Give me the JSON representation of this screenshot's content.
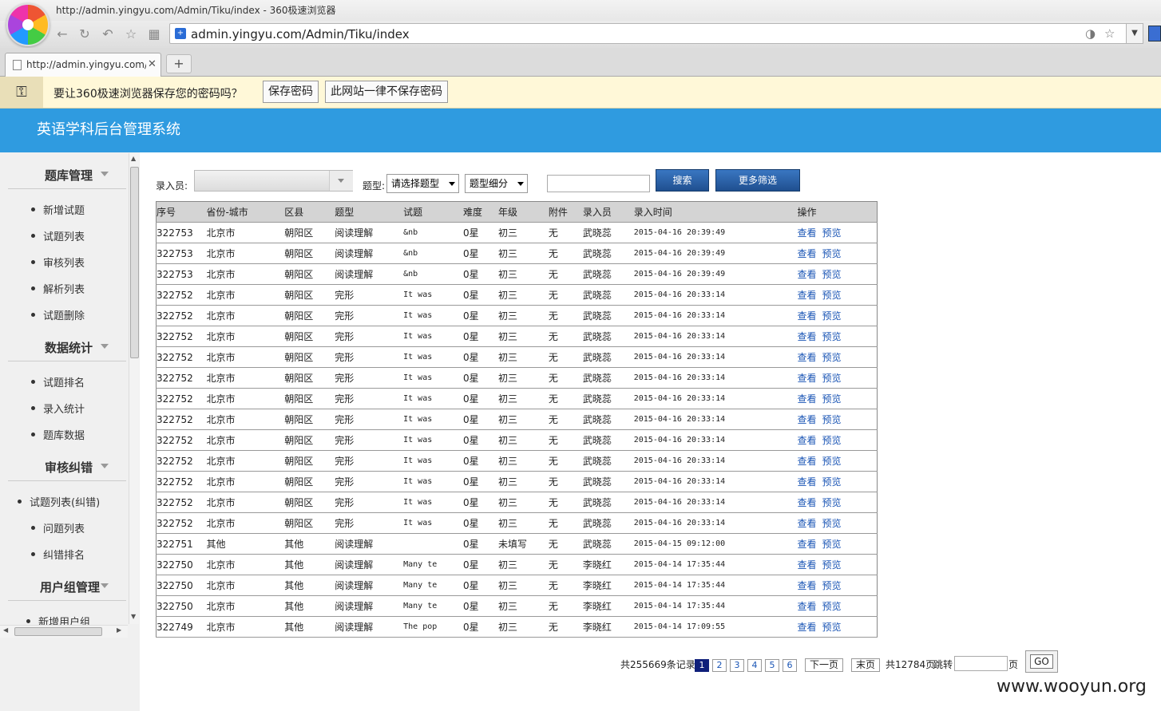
{
  "browser": {
    "window_title": "http://admin.yingyu.com/Admin/Tiku/index - 360极速浏览器",
    "url": "admin.yingyu.com/Admin/Tiku/index",
    "tab_title": "http://admin.yingyu.com/Admin/",
    "password_prompt": {
      "message": "要让360极速浏览器保存您的密码吗？",
      "save": "保存密码",
      "never": "此网站一律不保存密码"
    }
  },
  "app": {
    "title": "英语学科后台管理系统"
  },
  "sidebar": {
    "groups": [
      {
        "title": "题库管理",
        "items": [
          "新增试题",
          "试题列表",
          "审核列表",
          "解析列表",
          "试题删除"
        ]
      },
      {
        "title": "数据统计",
        "items": [
          "试题排名",
          "录入统计",
          "题库数据"
        ]
      },
      {
        "title": "审核纠错",
        "items": [
          "试题列表(纠错)",
          "问题列表",
          "纠错排名"
        ]
      },
      {
        "title": "用户组管理",
        "items": [
          "新增用户组"
        ]
      }
    ]
  },
  "filters": {
    "recorder_label": "录入员:",
    "type_label": "题型:",
    "type_select": "请选择题型",
    "subtype_select": "题型细分",
    "search": "搜索",
    "more": "更多筛选"
  },
  "table": {
    "headers": [
      "序号",
      "省份-城市",
      "区县",
      "题型",
      "试题",
      "难度",
      "年级",
      "附件",
      "录入员",
      "录入时间",
      "操作"
    ],
    "view": "查看",
    "preview": "预览",
    "rows": [
      [
        "322753",
        "北京市",
        "朝阳区",
        "阅读理解",
        "&nb",
        "0星",
        "初三",
        "无",
        "武晓蕊",
        "2015-04-16 20:39:49"
      ],
      [
        "322753",
        "北京市",
        "朝阳区",
        "阅读理解",
        "&nb",
        "0星",
        "初三",
        "无",
        "武晓蕊",
        "2015-04-16 20:39:49"
      ],
      [
        "322753",
        "北京市",
        "朝阳区",
        "阅读理解",
        "&nb",
        "0星",
        "初三",
        "无",
        "武晓蕊",
        "2015-04-16 20:39:49"
      ],
      [
        "322752",
        "北京市",
        "朝阳区",
        "完形",
        "It was",
        "0星",
        "初三",
        "无",
        "武晓蕊",
        "2015-04-16 20:33:14"
      ],
      [
        "322752",
        "北京市",
        "朝阳区",
        "完形",
        "It was",
        "0星",
        "初三",
        "无",
        "武晓蕊",
        "2015-04-16 20:33:14"
      ],
      [
        "322752",
        "北京市",
        "朝阳区",
        "完形",
        "It was",
        "0星",
        "初三",
        "无",
        "武晓蕊",
        "2015-04-16 20:33:14"
      ],
      [
        "322752",
        "北京市",
        "朝阳区",
        "完形",
        "It was",
        "0星",
        "初三",
        "无",
        "武晓蕊",
        "2015-04-16 20:33:14"
      ],
      [
        "322752",
        "北京市",
        "朝阳区",
        "完形",
        "It was",
        "0星",
        "初三",
        "无",
        "武晓蕊",
        "2015-04-16 20:33:14"
      ],
      [
        "322752",
        "北京市",
        "朝阳区",
        "完形",
        "It was",
        "0星",
        "初三",
        "无",
        "武晓蕊",
        "2015-04-16 20:33:14"
      ],
      [
        "322752",
        "北京市",
        "朝阳区",
        "完形",
        "It was",
        "0星",
        "初三",
        "无",
        "武晓蕊",
        "2015-04-16 20:33:14"
      ],
      [
        "322752",
        "北京市",
        "朝阳区",
        "完形",
        "It was",
        "0星",
        "初三",
        "无",
        "武晓蕊",
        "2015-04-16 20:33:14"
      ],
      [
        "322752",
        "北京市",
        "朝阳区",
        "完形",
        "It was",
        "0星",
        "初三",
        "无",
        "武晓蕊",
        "2015-04-16 20:33:14"
      ],
      [
        "322752",
        "北京市",
        "朝阳区",
        "完形",
        "It was",
        "0星",
        "初三",
        "无",
        "武晓蕊",
        "2015-04-16 20:33:14"
      ],
      [
        "322752",
        "北京市",
        "朝阳区",
        "完形",
        "It was",
        "0星",
        "初三",
        "无",
        "武晓蕊",
        "2015-04-16 20:33:14"
      ],
      [
        "322752",
        "北京市",
        "朝阳区",
        "完形",
        "It was",
        "0星",
        "初三",
        "无",
        "武晓蕊",
        "2015-04-16 20:33:14"
      ],
      [
        "322751",
        "其他",
        "其他",
        "阅读理解",
        "",
        "0星",
        "未填写",
        "无",
        "武晓蕊",
        "2015-04-15 09:12:00"
      ],
      [
        "322750",
        "北京市",
        "其他",
        "阅读理解",
        "Many te",
        "0星",
        "初三",
        "无",
        "李晓红",
        "2015-04-14 17:35:44"
      ],
      [
        "322750",
        "北京市",
        "其他",
        "阅读理解",
        "Many te",
        "0星",
        "初三",
        "无",
        "李晓红",
        "2015-04-14 17:35:44"
      ],
      [
        "322750",
        "北京市",
        "其他",
        "阅读理解",
        "Many te",
        "0星",
        "初三",
        "无",
        "李晓红",
        "2015-04-14 17:35:44"
      ],
      [
        "322749",
        "北京市",
        "其他",
        "阅读理解",
        "The pop",
        "0星",
        "初三",
        "无",
        "李晓红",
        "2015-04-14 17:09:55"
      ]
    ]
  },
  "pagination": {
    "total": "共255669条记录",
    "pages": [
      "1",
      "2",
      "3",
      "4",
      "5",
      "6"
    ],
    "next": "下一页",
    "last": "末页",
    "page_count": "共12784页",
    "jump_label": "跳转",
    "page_unit": "页",
    "go": "GO"
  },
  "watermark": "www.wooyun.org",
  "colors": {
    "header_bg": "#2f9be0",
    "button_bg": "#1f4f8f",
    "link": "#1a55b5",
    "active_page": "#0f1f7a"
  }
}
